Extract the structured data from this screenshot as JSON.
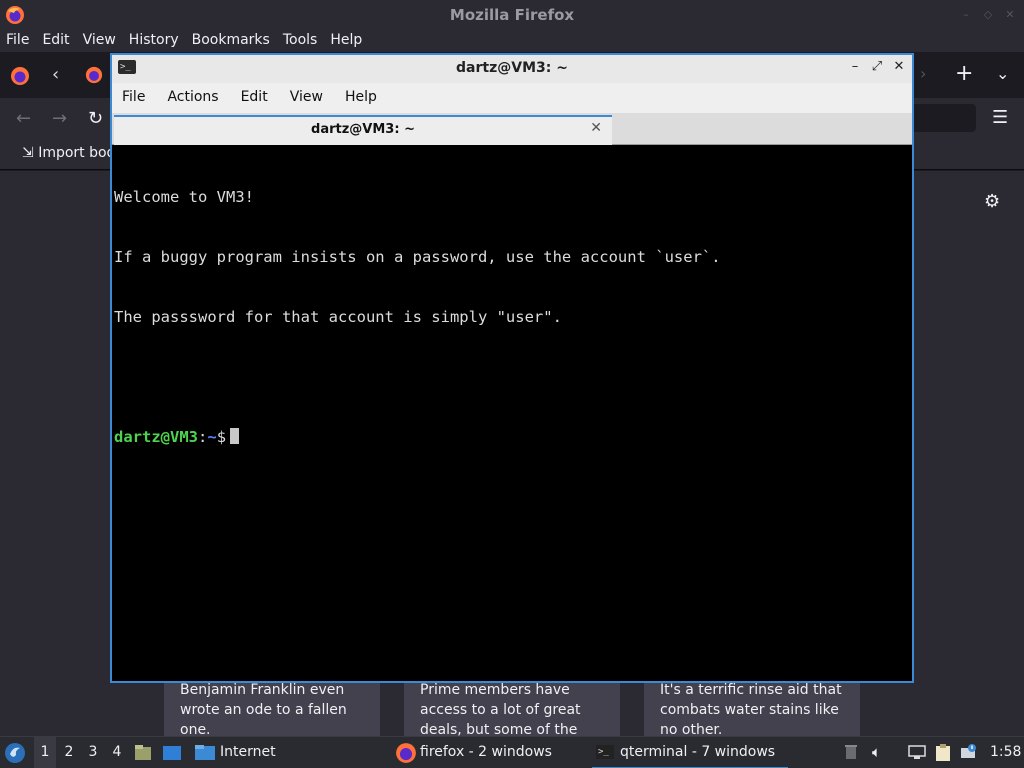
{
  "firefox": {
    "window_title": "Mozilla Firefox",
    "menu": [
      "File",
      "Edit",
      "View",
      "History",
      "Bookmarks",
      "Tools",
      "Help"
    ],
    "bookmarks_bar": {
      "import_label": "Import boo"
    },
    "story_cards": [
      {
        "text": "Benjamin Franklin even wrote an ode to a fallen one."
      },
      {
        "text": "Prime members have access to a lot of great deals, but some of the best ones are…"
      },
      {
        "text": "It's a terrific rinse aid that combats water stains like no other."
      }
    ]
  },
  "terminal": {
    "window_title": "dartz@VM3: ~",
    "menu": [
      "File",
      "Actions",
      "Edit",
      "View",
      "Help"
    ],
    "tab_label": "dartz@VM3: ~",
    "lines": [
      "Welcome to VM3!",
      "If a buggy program insists on a password, use the account `user`.",
      "The passsword for that account is simply \"user\"."
    ],
    "prompt": {
      "user_host": "dartz@VM3",
      "separator": ":",
      "path": "~",
      "symbol": "$"
    }
  },
  "taskbar": {
    "desktops": [
      "1",
      "2",
      "3",
      "4"
    ],
    "active_desktop": "1",
    "quicklaunch_label": "Internet",
    "tasks": [
      {
        "label": "firefox - 2 windows",
        "icon": "firefox-icon"
      },
      {
        "label": "qterminal - 7 windows",
        "icon": "terminal-icon",
        "active": true
      }
    ],
    "clock": "1:58"
  },
  "colors": {
    "accent": "#3c8ad3",
    "prompt_user": "#4fd34f",
    "prompt_path": "#5b82ff"
  }
}
